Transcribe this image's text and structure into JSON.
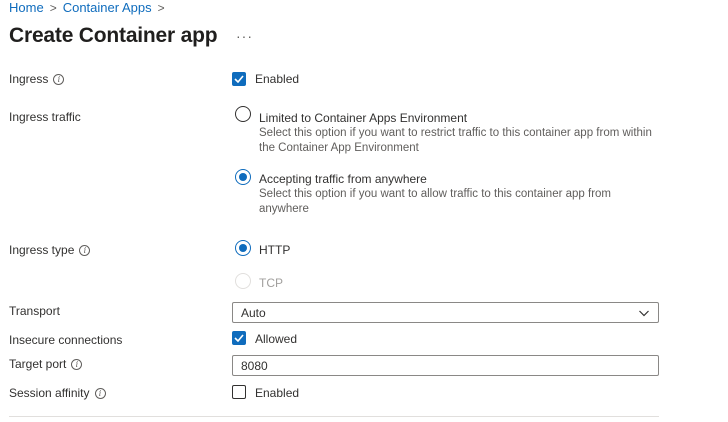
{
  "breadcrumb": {
    "items": [
      "Home",
      "Container Apps"
    ],
    "separator": ">"
  },
  "page": {
    "title": "Create Container app",
    "more": "···"
  },
  "form": {
    "ingress": {
      "label": "Ingress",
      "checkbox_label": "Enabled",
      "checked": true
    },
    "ingress_traffic": {
      "label": "Ingress traffic",
      "options": [
        {
          "label": "Limited to Container Apps Environment",
          "description": "Select this option if you want to restrict traffic to this container app from within the Container App Environment",
          "selected": false
        },
        {
          "label": "Accepting traffic from anywhere",
          "description": "Select this option if you want to allow traffic to this container app from anywhere",
          "selected": true
        }
      ]
    },
    "ingress_type": {
      "label": "Ingress type",
      "options": [
        {
          "label": "HTTP",
          "selected": true,
          "disabled": false
        },
        {
          "label": "TCP",
          "selected": false,
          "disabled": true
        }
      ]
    },
    "transport": {
      "label": "Transport",
      "value": "Auto"
    },
    "insecure_connections": {
      "label": "Insecure connections",
      "checkbox_label": "Allowed",
      "checked": true
    },
    "target_port": {
      "label": "Target port",
      "value": "8080"
    },
    "session_affinity": {
      "label": "Session affinity",
      "checkbox_label": "Enabled",
      "checked": false
    }
  },
  "colors": {
    "accent": "#0f6cbd",
    "text": "#323130",
    "muted": "#605e5c",
    "disabled": "#a19f9d"
  }
}
